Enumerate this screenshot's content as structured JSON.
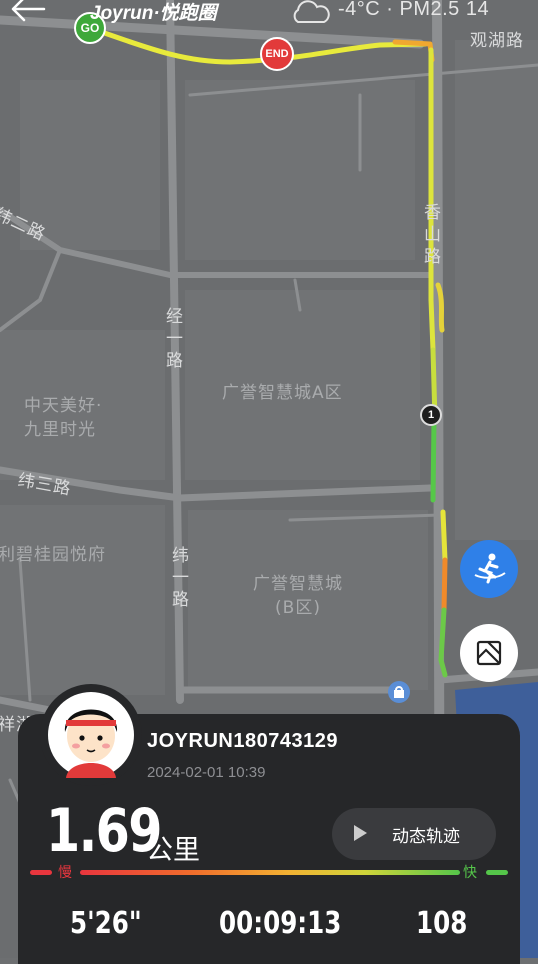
{
  "header": {
    "back_icon": "arrow-left-icon",
    "brand": "Joyrun·悦跑圈",
    "weather_icon": "cloud-icon",
    "weather_text": "-4°C · PM2.5 14"
  },
  "map": {
    "labels": {
      "guanhu_road": "观湖路",
      "xiangshan_road": "香山路",
      "wei_er_road": "纬二路",
      "jing_yi_road": "经一路",
      "guangyu_a": "广誉智慧城A区",
      "zhongtian": "中天美好·九里时光",
      "wei_san_road": "纬三路",
      "bigui": "利碧桂园悦府",
      "wei_yi_road": "纬一路",
      "guangyu_b": "广誉智慧城(B区)",
      "xiang_hu": "祥湖"
    },
    "markers": {
      "start": "GO",
      "end": "END",
      "km1": "1"
    },
    "colors": {
      "route_fast": "#4cc84a",
      "route_mid": "#e6e63a",
      "route_slow": "#f08a2a",
      "start": "#3ea83a",
      "end": "#e23a3a"
    }
  },
  "fabs": {
    "run_mode_icon": "runner-icon",
    "snapshot_icon": "image-frame-icon"
  },
  "panel": {
    "avatar": "avatar",
    "username": "JOYRUN180743129",
    "datetime": "2024-02-01 10:39",
    "distance": "1.69",
    "unit": "公里",
    "track_button": "动态轨迹",
    "pace_slow": "慢",
    "pace_fast": "快",
    "stats": {
      "pace": "5'26\"",
      "duration": "00:09:13",
      "cadence": "108"
    }
  }
}
